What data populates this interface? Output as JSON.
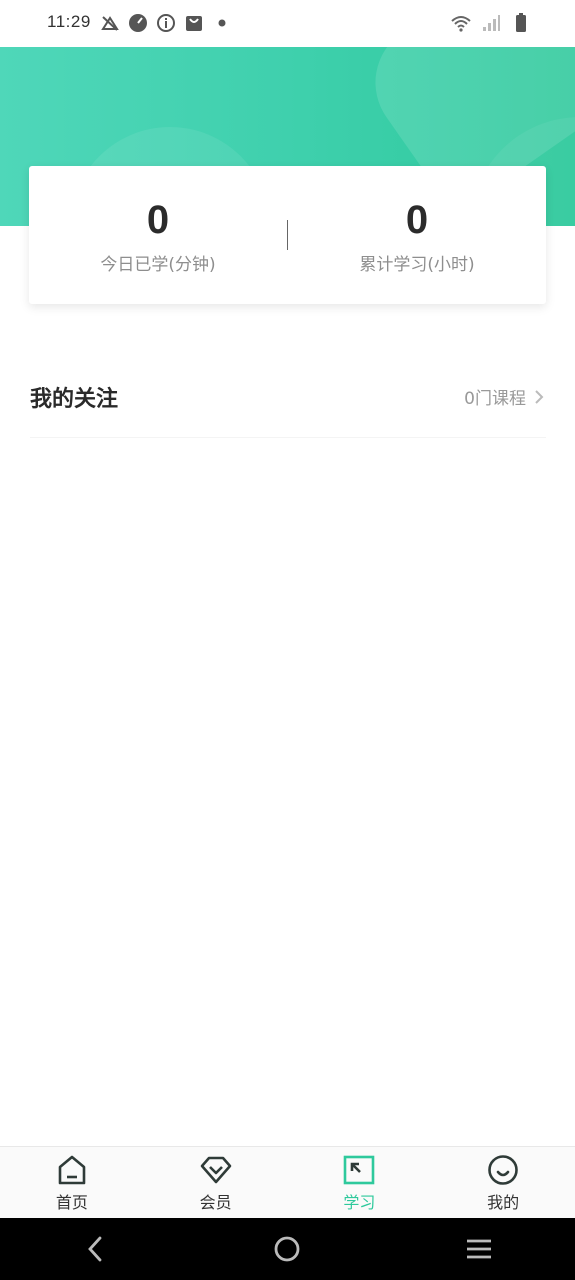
{
  "status_bar": {
    "time": "11:29",
    "left_icons": [
      "no-ads-icon",
      "speedometer-icon",
      "info-icon",
      "shopping-bag-icon",
      "dot-icon"
    ],
    "right_icons": [
      "wifi-icon",
      "signal-icon",
      "battery-icon"
    ]
  },
  "stats": {
    "today_value": "0",
    "today_label": "今日已学(分钟)",
    "total_value": "0",
    "total_label": "累计学习(小时)"
  },
  "follow": {
    "title": "我的关注",
    "count_label": "0门课程"
  },
  "tabs": [
    {
      "label": "首页",
      "icon": "home-icon",
      "active": false
    },
    {
      "label": "会员",
      "icon": "diamond-icon",
      "active": false
    },
    {
      "label": "学习",
      "icon": "learn-icon",
      "active": true
    },
    {
      "label": "我的",
      "icon": "profile-icon",
      "active": false
    }
  ],
  "colors": {
    "accent": "#2ec99c",
    "hero_start": "#4fd7b9",
    "hero_end": "#2ec99c"
  },
  "nav_bar": [
    "back-icon",
    "home-circle-icon",
    "menu-icon"
  ]
}
